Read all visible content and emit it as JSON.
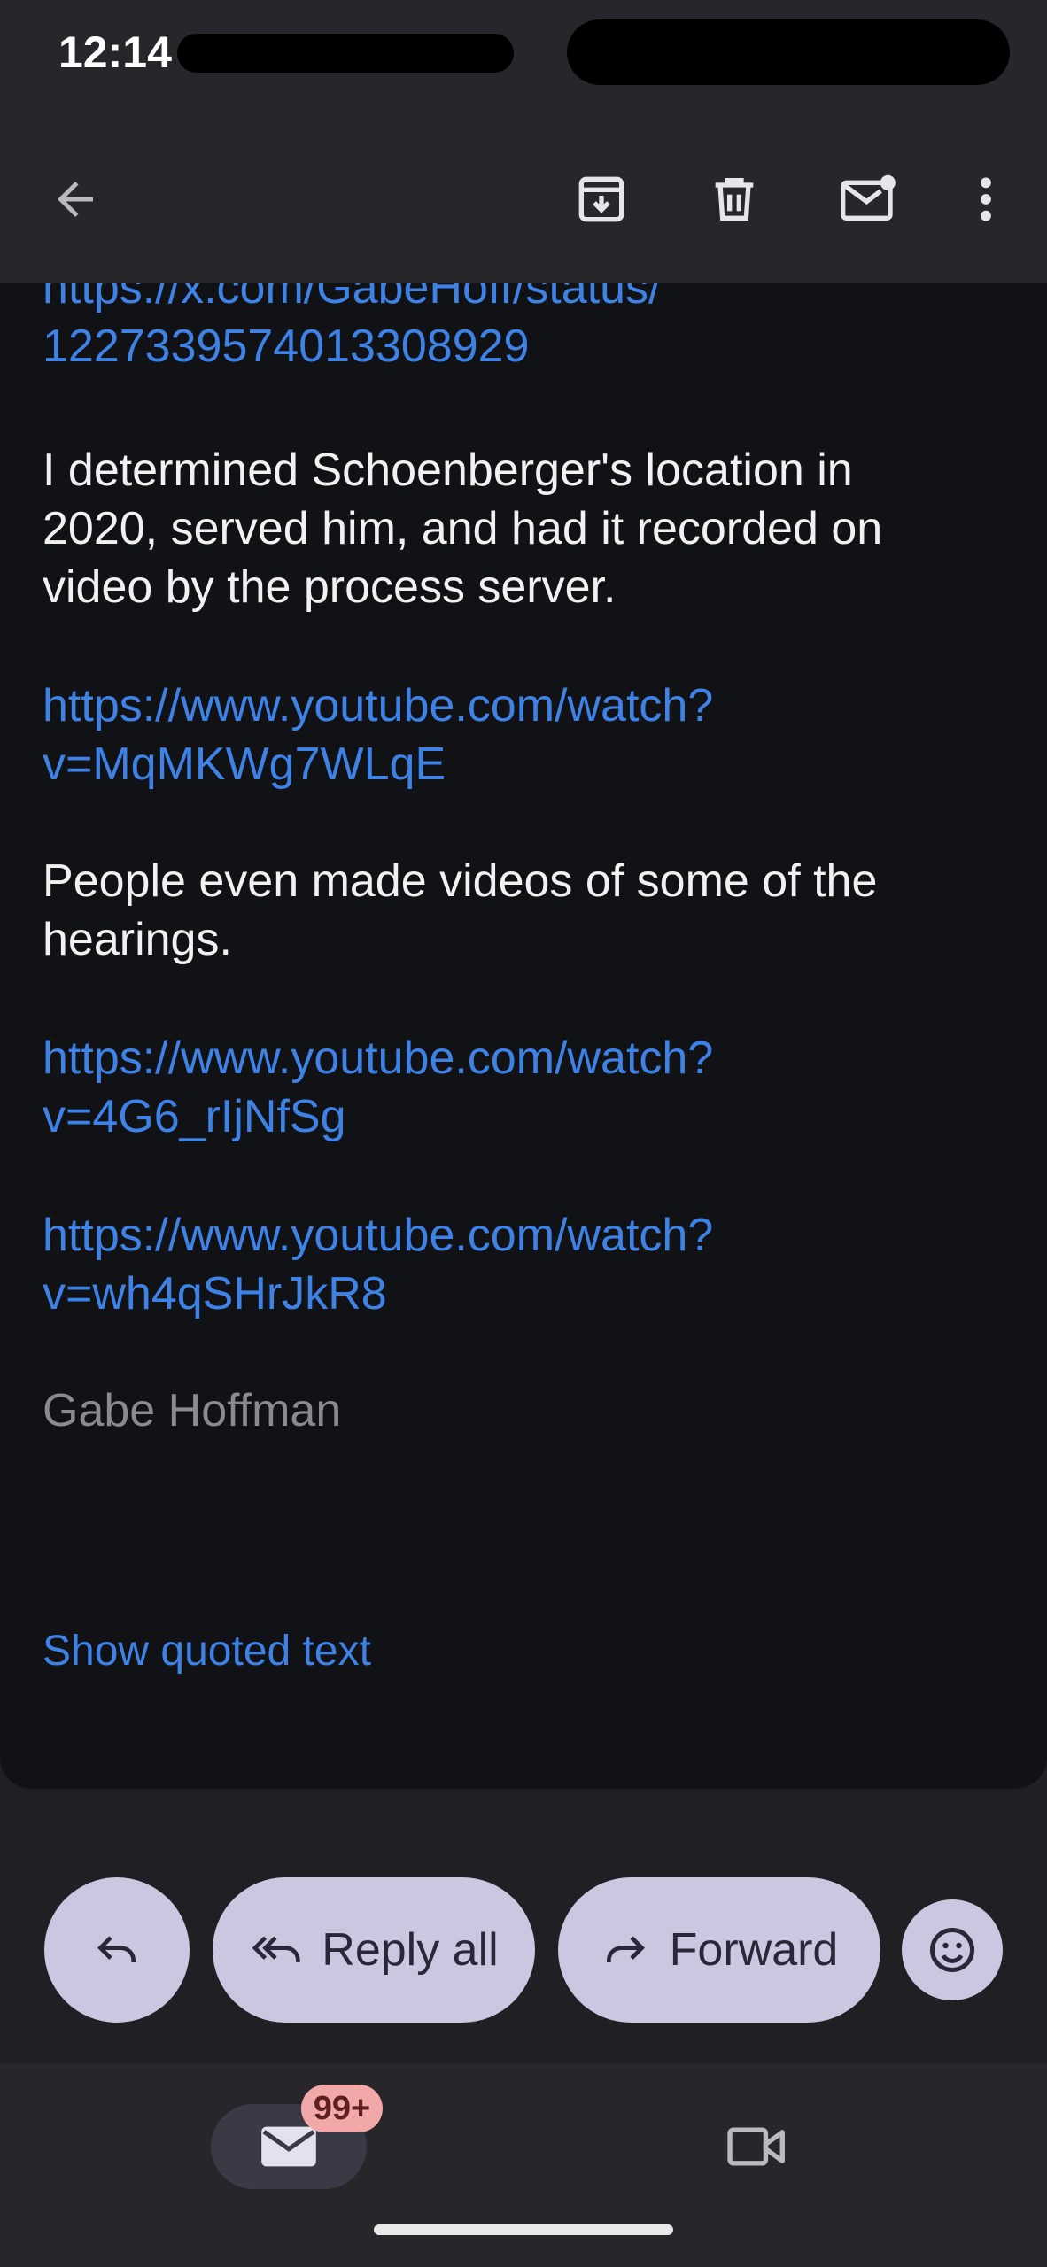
{
  "status_bar": {
    "time": "12:14"
  },
  "toolbar": {
    "back_icon": "arrow-left-icon",
    "archive_icon": "archive-icon",
    "delete_icon": "trash-icon",
    "mark_unread_icon": "mail-unread-icon",
    "more_icon": "more-vert-icon"
  },
  "email": {
    "link_status_line1": "https://x.com/GabeHoff/status/",
    "link_status_line2": "1227339574013308929",
    "para1_line1": "I determined Schoenberger's location in",
    "para1_line2": "2020, served him, and had it recorded on",
    "para1_line3": "video by the process server.",
    "link1_line1": "https://www.youtube.com/watch?",
    "link1_line2": "v=MqMKWg7WLqE",
    "para2_line1": "People even made videos of some of the",
    "para2_line2": "hearings.",
    "link2_line1": "https://www.youtube.com/watch?",
    "link2_line2": "v=4G6_rIjNfSg",
    "link3_line1": "https://www.youtube.com/watch?",
    "link3_line2": "v=wh4qSHrJkR8",
    "signature": "Gabe Hoffman",
    "show_quoted": "Show quoted text"
  },
  "actions": {
    "reply_all_label": "Reply all",
    "forward_label": "Forward"
  },
  "bottom_nav": {
    "mail_badge": "99+"
  },
  "colors": {
    "link": "#3e82e6",
    "pill_bg": "#cbc7e1",
    "badge_bg": "#f2a7a8"
  }
}
